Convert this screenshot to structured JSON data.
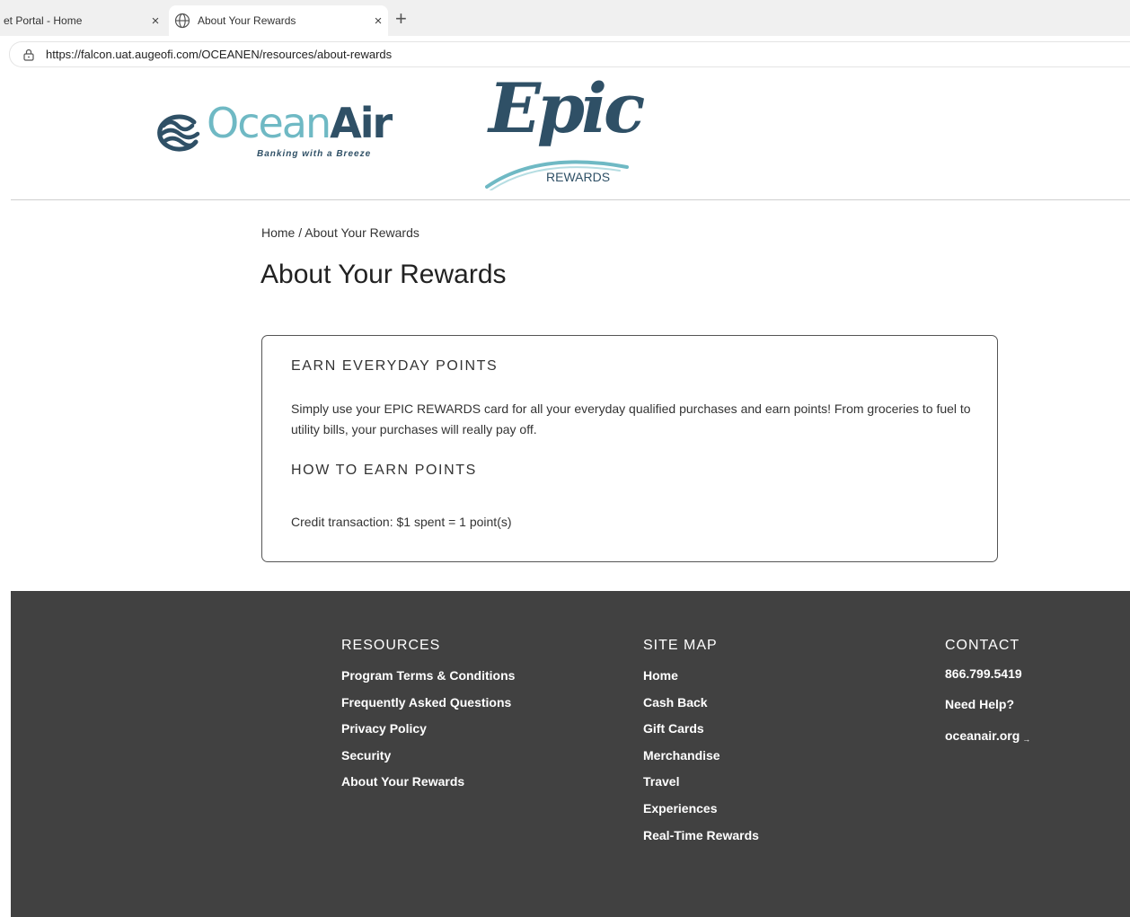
{
  "browser": {
    "tabs": [
      {
        "title": "et Portal - Home",
        "active": false
      },
      {
        "title": "About Your Rewards",
        "active": true
      }
    ],
    "close_glyph": "×",
    "new_tab_glyph": "+",
    "url": "https://falcon.uat.augeofi.com/OCEANEN/resources/about-rewards"
  },
  "header": {
    "oceanair_logo": {
      "ocean": "Ocean",
      "air": "Air",
      "tagline": "Banking with a Breeze"
    },
    "epic_logo": {
      "word": "Epic",
      "sub": "REWARDS"
    }
  },
  "main": {
    "breadcrumb": "Home / About Your Rewards",
    "title": "About Your Rewards",
    "card": {
      "heading1": "EARN EVERYDAY POINTS",
      "paragraph": "Simply use your EPIC REWARDS card for all your everyday qualified purchases and earn points! From groceries to fuel to utility bills, your purchases will really pay off.",
      "heading2": "HOW TO EARN POINTS",
      "credit_line": "Credit transaction: $1 spent = 1 point(s)"
    }
  },
  "footer": {
    "resources": {
      "heading": "RESOURCES",
      "links": [
        "Program Terms & Conditions",
        "Frequently Asked Questions",
        "Privacy Policy",
        "Security",
        "About Your Rewards"
      ]
    },
    "sitemap": {
      "heading": "SITE MAP",
      "links": [
        "Home",
        "Cash Back",
        "Gift Cards",
        "Merchandise",
        "Travel",
        "Experiences",
        "Real-Time Rewards"
      ]
    },
    "contact": {
      "heading": "CONTACT",
      "phone": "866.799.5419",
      "help": "Need Help?",
      "website": "oceanair.org",
      "external_glyph": "→"
    }
  },
  "colors": {
    "brand_teal": "#6fb9c4",
    "brand_navy": "#2f5066",
    "footer_bg": "#414141"
  }
}
